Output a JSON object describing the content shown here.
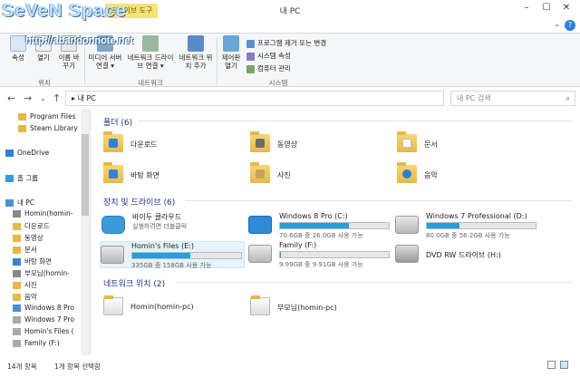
{
  "watermark": {
    "title": "SeVeN Space",
    "url": "http://abandonnote.net"
  },
  "window": {
    "title": "내 PC",
    "context_tab": "드라이브 도구"
  },
  "ribbon": {
    "buttons": [
      {
        "label": "속성"
      },
      {
        "label": "열기"
      },
      {
        "label": "이름 바꾸기"
      },
      {
        "label": "미디어 서버 연결 ▾"
      },
      {
        "label": "네트워크 드라이브 연결 ▾"
      },
      {
        "label": "네트워크 위치 추가"
      },
      {
        "label": "제어판 열기"
      }
    ],
    "system_items": [
      "프로그램 제거 또는 변경",
      "시스템 속성",
      "컴퓨터 관리"
    ],
    "groups": [
      "위치",
      "네트워크",
      "시스템"
    ]
  },
  "address": {
    "path": "내 PC",
    "search_placeholder": "내 PC 검색"
  },
  "nav_pane": {
    "items": [
      "Program Files",
      "Steam Library",
      "OneDrive",
      "홈 그룹",
      "내 PC",
      "Homin(homin-",
      "다운로드",
      "동영상",
      "문서",
      "바탕 화면",
      "부모님(homin-",
      "사진",
      "음악",
      "Windows 8 Pro",
      "Windows 7 Pro",
      "Homin's Files (",
      "Family (F:)"
    ]
  },
  "sections": {
    "folders": "폴더 (6)",
    "drives": "장치 및 드라이브 (6)",
    "network": "네트워크 위치 (2)"
  },
  "folders": [
    {
      "name": "다운로드",
      "color": "#2f7fd8"
    },
    {
      "name": "동영상",
      "color": "#6b6b6b"
    },
    {
      "name": "문서",
      "color": "#ffffff"
    },
    {
      "name": "바탕 화면",
      "color": "#3a82d0"
    },
    {
      "name": "사진",
      "color": "#c2a55a"
    },
    {
      "name": "음악",
      "color": "#2f7fd8"
    }
  ],
  "drives": [
    {
      "name": "바이두 클라우드",
      "sub": "실행하려면 더블클릭",
      "fill": null
    },
    {
      "name": "Windows 8 Pro (C:)",
      "size": "70.6GB 중 26.0GB 사용 가능",
      "fill": 0.63
    },
    {
      "name": "Windows 7 Professional (D:)",
      "size": "80.0GB 중 56.2GB 사용 가능",
      "fill": 0.3
    },
    {
      "name": "Homin's Files (E:)",
      "size": "335GB 중 158GB 사용 가능",
      "fill": 0.53
    },
    {
      "name": "Family (F:)",
      "size": "9.99GB 중 9.91GB 사용 가능",
      "fill": 0.01
    },
    {
      "name": "DVD RW 드라이브 (H:)",
      "fill": null
    }
  ],
  "network": [
    {
      "name": "Homin(homin-pc)"
    },
    {
      "name": "부모님(homin-pc)"
    }
  ],
  "status": {
    "count": "14개 항목",
    "selected": "1개 항목 선택함"
  }
}
